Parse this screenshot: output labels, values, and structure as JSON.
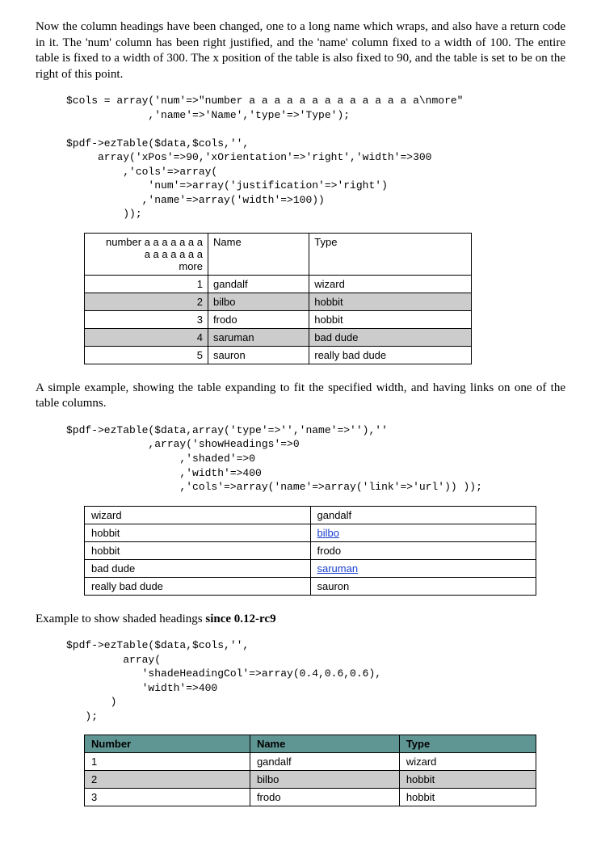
{
  "para1": "Now the column headings have been changed, one to a long name which wraps, and also have a return code in it. The 'num' column has been right justified, and the 'name' column fixed to a width of 100. The entire table is fixed to a width of 300. The x position of the table is also fixed to 90, and the table is set to be on the right of this point.",
  "code1": "$cols = array('num'=>\"number a a a a a a a a a a a a a a\\nmore\"\n             ,'name'=>'Name','type'=>'Type');\n\n$pdf->ezTable($data,$cols,'',\n     array('xPos'=>90,'xOrientation'=>'right','width'=>300\n         ,'cols'=>array(\n             'num'=>array('justification'=>'right')\n            ,'name'=>array('width'=>100))\n         ));",
  "table1": {
    "headers": {
      "num": "number a a a a a a a\na a a a a a a\nmore",
      "name": "Name",
      "type": "Type"
    },
    "rows": [
      {
        "num": "1",
        "name": "gandalf",
        "type": "wizard",
        "shade": false
      },
      {
        "num": "2",
        "name": "bilbo",
        "type": "hobbit",
        "shade": true
      },
      {
        "num": "3",
        "name": "frodo",
        "type": "hobbit",
        "shade": false
      },
      {
        "num": "4",
        "name": "saruman",
        "type": "bad dude",
        "shade": true
      },
      {
        "num": "5",
        "name": "sauron",
        "type": "really bad dude",
        "shade": false
      }
    ]
  },
  "para2": "A simple example, showing the table expanding to fit the specified width, and having links on one of the table columns.",
  "code2": "$pdf->ezTable($data,array('type'=>'','name'=>''),''\n             ,array('showHeadings'=>0\n                  ,'shaded'=>0\n                  ,'width'=>400\n                  ,'cols'=>array('name'=>array('link'=>'url')) ));",
  "table2": {
    "rows": [
      {
        "type": "wizard",
        "name": "gandalf",
        "link": false
      },
      {
        "type": "hobbit",
        "name": "bilbo",
        "link": true
      },
      {
        "type": "hobbit",
        "name": "frodo",
        "link": false
      },
      {
        "type": "bad dude",
        "name": "saruman",
        "link": true
      },
      {
        "type": "really bad dude",
        "name": "sauron",
        "link": false
      }
    ]
  },
  "para3_prefix": "Example to show shaded headings ",
  "para3_bold": "since 0.12-rc9",
  "code3": "$pdf->ezTable($data,$cols,'',\n         array(\n            'shadeHeadingCol'=>array(0.4,0.6,0.6),\n            'width'=>400\n       )\n   );",
  "table3": {
    "headers": {
      "num": "Number",
      "name": "Name",
      "type": "Type"
    },
    "rows": [
      {
        "num": "1",
        "name": "gandalf",
        "type": "wizard",
        "shade": false
      },
      {
        "num": "2",
        "name": "bilbo",
        "type": "hobbit",
        "shade": true
      },
      {
        "num": "3",
        "name": "frodo",
        "type": "hobbit",
        "shade": false
      }
    ]
  },
  "colors": {
    "shadeHeading": "#5f9694"
  }
}
